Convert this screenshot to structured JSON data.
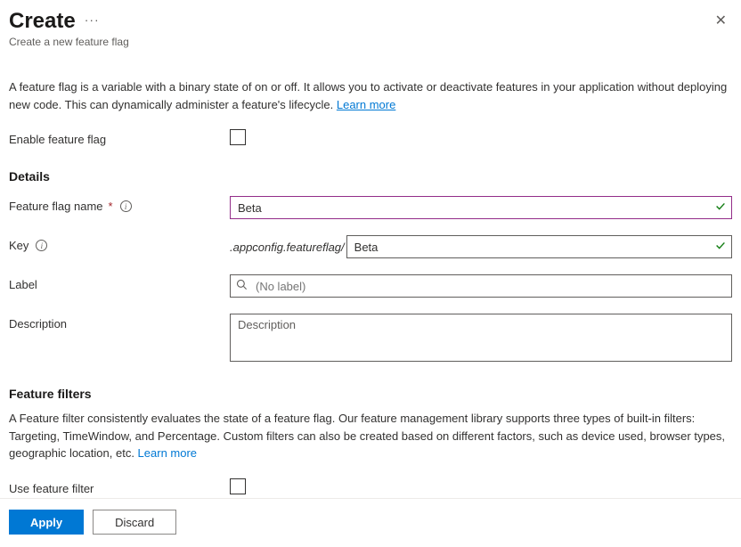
{
  "header": {
    "title": "Create",
    "subtitle": "Create a new feature flag"
  },
  "intro": {
    "text": "A feature flag is a variable with a binary state of on or off. It allows you to activate or deactivate features in your application without deploying new code. This can dynamically administer a feature's lifecycle. ",
    "learn_more": "Learn more"
  },
  "enable": {
    "label": "Enable feature flag",
    "checked": false
  },
  "details": {
    "heading": "Details",
    "name": {
      "label": "Feature flag name",
      "required": "*",
      "value": "Beta"
    },
    "key": {
      "label": "Key",
      "prefix": ".appconfig.featureflag/",
      "value": "Beta"
    },
    "labelField": {
      "label": "Label",
      "placeholder": "(No label)",
      "value": ""
    },
    "description": {
      "label": "Description",
      "placeholder": "Description",
      "value": ""
    }
  },
  "filters": {
    "heading": "Feature filters",
    "text": "A Feature filter consistently evaluates the state of a feature flag. Our feature management library supports three types of built-in filters: Targeting, TimeWindow, and Percentage. Custom filters can also be created based on different factors, such as device used, browser types, geographic location, etc. ",
    "learn_more": "Learn more",
    "use": {
      "label": "Use feature filter",
      "checked": false
    }
  },
  "footer": {
    "apply": "Apply",
    "discard": "Discard"
  }
}
